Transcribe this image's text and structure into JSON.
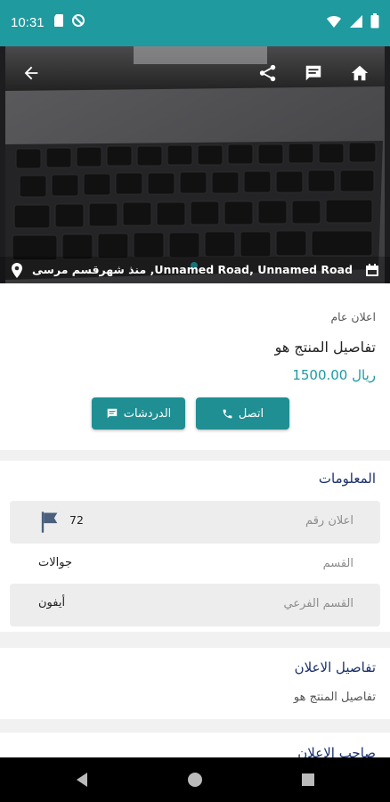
{
  "status_bar": {
    "time": "10:31",
    "left_icons": [
      "sim-card-icon",
      "no-data-icon"
    ],
    "right_icons": [
      "wifi-icon",
      "signal-icon",
      "battery-icon"
    ]
  },
  "hero": {
    "toolbar_icons": [
      "back-arrow-icon",
      "share-icon",
      "comment-icon",
      "home-icon"
    ],
    "caption": "منذ شهرقسم مرسى ,Unnamed Road, Unnamed Road"
  },
  "ad": {
    "type": "اعلان عام",
    "title": "تفاصيل المنتج هو",
    "price": "1500.00 ريال"
  },
  "actions": {
    "call_label": "اتصل",
    "chats_label": "الدردشات"
  },
  "info": {
    "heading": "المعلومات",
    "rows": [
      {
        "label": "اعلان رقم",
        "value": "72"
      },
      {
        "label": "القسم",
        "value": "جوالات"
      },
      {
        "label": "القسم الفرعي",
        "value": "أيفون"
      }
    ]
  },
  "details": {
    "heading": "تفاصيل الاعلان",
    "text": "تفاصيل المنتج هو"
  },
  "owner": {
    "heading": "صاحب الاعلان"
  },
  "colors": {
    "accent": "#1f9a9f",
    "heading": "#1a2f6b"
  }
}
